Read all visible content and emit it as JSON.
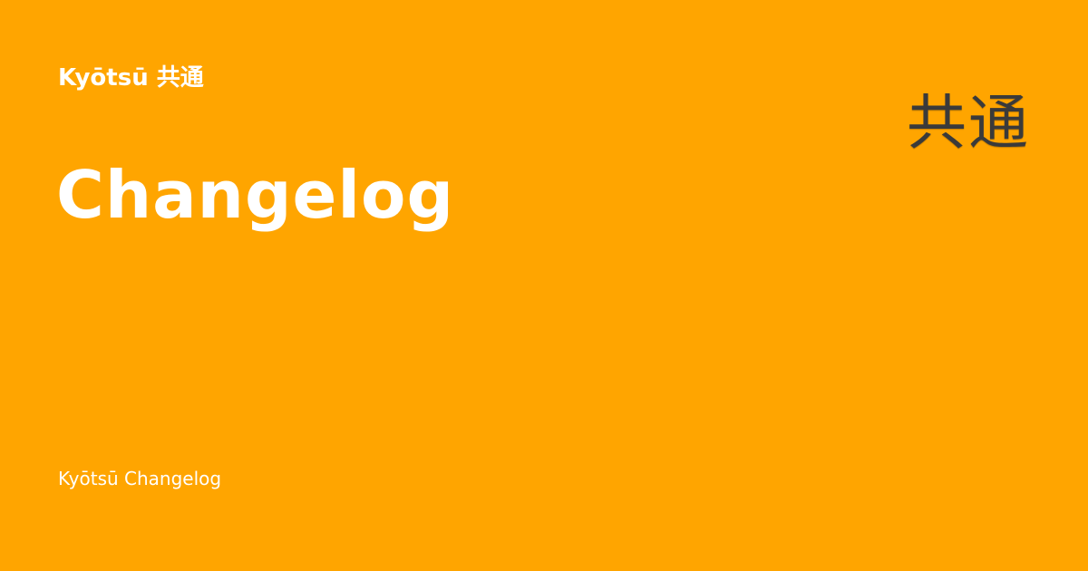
{
  "site": {
    "name": "Kyōtsū 共通"
  },
  "page": {
    "title": "Changelog"
  },
  "logo": {
    "text": "共通",
    "color": "#3a3a3a"
  },
  "footer": {
    "text": "Kyōtsū Changelog"
  },
  "colors": {
    "background": "#FFA500",
    "text": "#ffffff"
  }
}
